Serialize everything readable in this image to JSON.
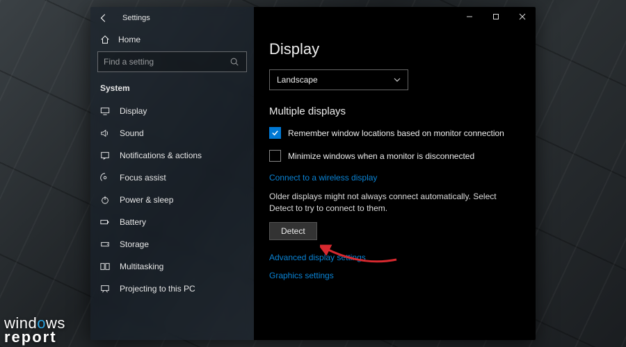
{
  "window": {
    "title": "Settings",
    "home_label": "Home",
    "search_placeholder": "Find a setting",
    "section_label": "System"
  },
  "sidebar": {
    "items": [
      {
        "icon": "display",
        "label": "Display"
      },
      {
        "icon": "sound",
        "label": "Sound"
      },
      {
        "icon": "notifications",
        "label": "Notifications & actions"
      },
      {
        "icon": "focus",
        "label": "Focus assist"
      },
      {
        "icon": "power",
        "label": "Power & sleep"
      },
      {
        "icon": "battery",
        "label": "Battery"
      },
      {
        "icon": "storage",
        "label": "Storage"
      },
      {
        "icon": "multitask",
        "label": "Multitasking"
      },
      {
        "icon": "project",
        "label": "Projecting to this PC"
      }
    ]
  },
  "main": {
    "page_title": "Display",
    "orientation_value": "Landscape",
    "subhead": "Multiple displays",
    "remember_label": "Remember window locations based on monitor connection",
    "remember_checked": true,
    "minimize_label": "Minimize windows when a monitor is disconnected",
    "minimize_checked": false,
    "wireless_link": "Connect to a wireless display",
    "help_text": "Older displays might not always connect automatically. Select Detect to try to connect to them.",
    "detect_label": "Detect",
    "advanced_link": "Advanced display settings",
    "graphics_link": "Graphics settings"
  },
  "watermark": {
    "line1a": "wind",
    "line1b": "ws",
    "line2": "report"
  },
  "colors": {
    "accent": "#0078d4",
    "link": "#0a84d6",
    "arrow": "#d8292f"
  }
}
